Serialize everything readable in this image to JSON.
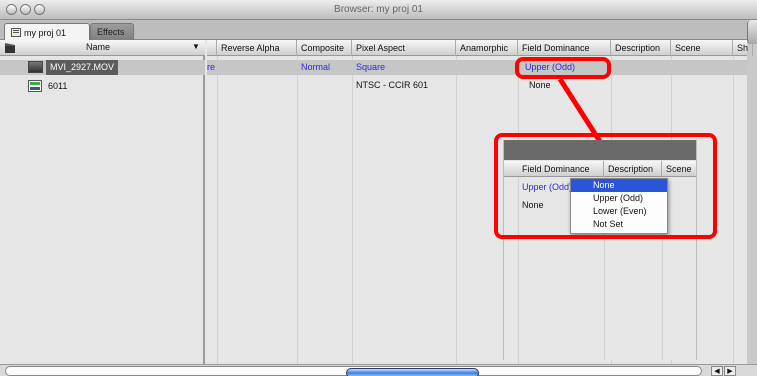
{
  "window": {
    "title": "Browser: my proj 01"
  },
  "tabs": [
    {
      "label": "my proj 01",
      "active": true
    },
    {
      "label": "Effects",
      "active": false
    }
  ],
  "left_pane": {
    "header": "Name",
    "items": [
      {
        "name": "MVI_2927.MOV",
        "icon": "video-clip-icon",
        "selected": true
      },
      {
        "name": "6011",
        "icon": "sequence-icon",
        "selected": false
      }
    ]
  },
  "columns": [
    "Reverse Alpha",
    "Composite",
    "Pixel Aspect",
    "Anamorphic",
    "Field Dominance",
    "Description",
    "Scene",
    "Sh"
  ],
  "rows": [
    {
      "first_cut": "re",
      "reverse_alpha": "",
      "composite": "Normal",
      "pixel_aspect": "Square",
      "anamorphic": "",
      "field_dominance": "Upper (Odd)"
    },
    {
      "first_cut": "",
      "reverse_alpha": "",
      "composite": "",
      "pixel_aspect": "NTSC - CCIR 601",
      "anamorphic": "",
      "field_dominance": "None"
    }
  ],
  "inset": {
    "columns": [
      "Field Dominance",
      "Description",
      "Scene"
    ],
    "row1_value": "Upper (Odd)",
    "row2_value": "None",
    "menu_items": [
      "None",
      "Upper (Odd)",
      "Lower (Even)",
      "Not Set"
    ],
    "menu_selected_index": 0
  },
  "colors": {
    "highlight_red": "#ff0000",
    "link_blue": "#2a2ad6",
    "menu_selected": "#2b55d8"
  }
}
